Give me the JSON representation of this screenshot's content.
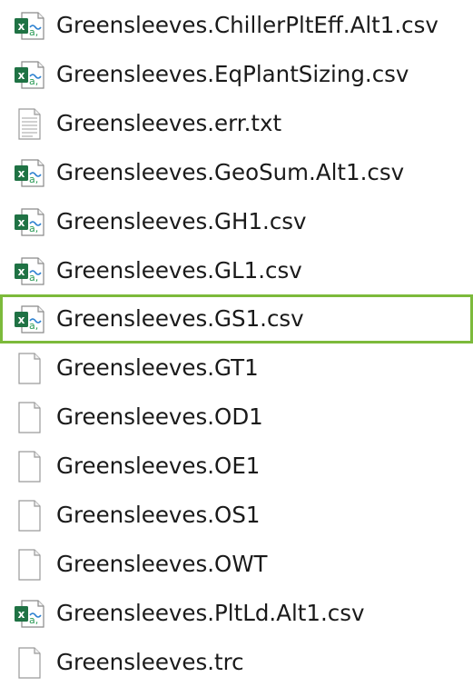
{
  "colors": {
    "highlight_border": "#7cba3b",
    "excel_green": "#1f7244",
    "text": "#1a1a1a"
  },
  "files": [
    {
      "name": "Greensleeves.ChillerPltEff.Alt1.csv",
      "icon": "excel-csv-icon",
      "highlighted": false
    },
    {
      "name": "Greensleeves.EqPlantSizing.csv",
      "icon": "excel-csv-icon",
      "highlighted": false
    },
    {
      "name": "Greensleeves.err.txt",
      "icon": "text-file-icon",
      "highlighted": false
    },
    {
      "name": "Greensleeves.GeoSum.Alt1.csv",
      "icon": "excel-csv-icon",
      "highlighted": false
    },
    {
      "name": "Greensleeves.GH1.csv",
      "icon": "excel-csv-icon",
      "highlighted": false
    },
    {
      "name": "Greensleeves.GL1.csv",
      "icon": "excel-csv-icon",
      "highlighted": false
    },
    {
      "name": "Greensleeves.GS1.csv",
      "icon": "excel-csv-icon",
      "highlighted": true
    },
    {
      "name": "Greensleeves.GT1",
      "icon": "blank-file-icon",
      "highlighted": false
    },
    {
      "name": "Greensleeves.OD1",
      "icon": "blank-file-icon",
      "highlighted": false
    },
    {
      "name": "Greensleeves.OE1",
      "icon": "blank-file-icon",
      "highlighted": false
    },
    {
      "name": "Greensleeves.OS1",
      "icon": "blank-file-icon",
      "highlighted": false
    },
    {
      "name": "Greensleeves.OWT",
      "icon": "blank-file-icon",
      "highlighted": false
    },
    {
      "name": "Greensleeves.PltLd.Alt1.csv",
      "icon": "excel-csv-icon",
      "highlighted": false
    },
    {
      "name": "Greensleeves.trc",
      "icon": "blank-file-icon",
      "highlighted": false
    }
  ]
}
